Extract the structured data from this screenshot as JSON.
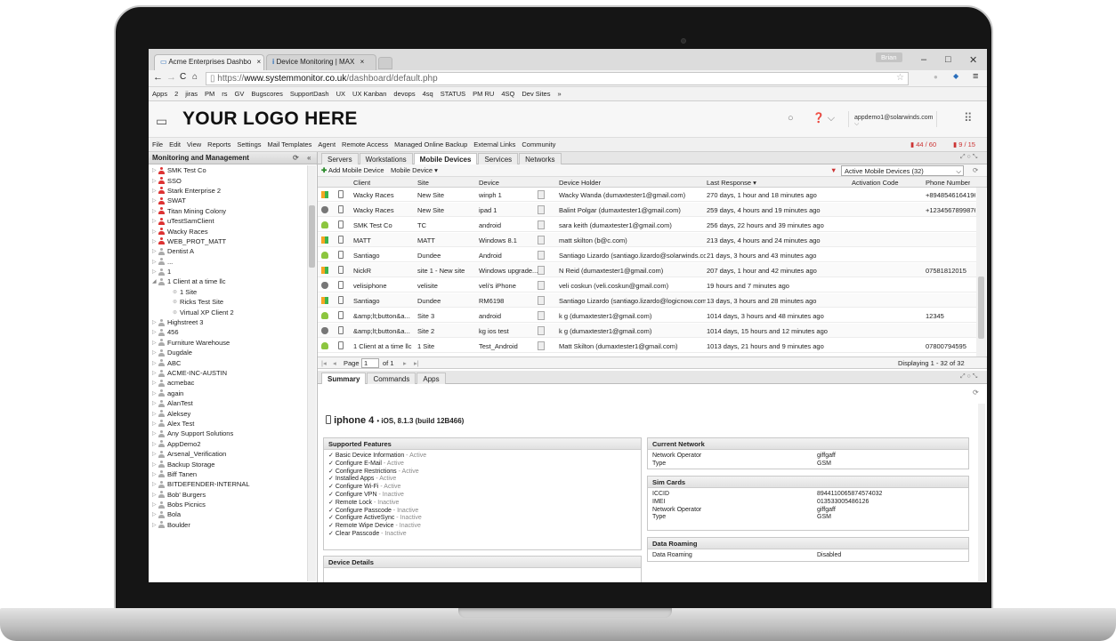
{
  "browser": {
    "tabs": [
      {
        "label": "Acme Enterprises Dashbo"
      },
      {
        "label": "Device Monitoring | MAX"
      }
    ],
    "user_label": "Brian",
    "url_prefix": "https://",
    "url_host": "www.systemmonitor.co.uk",
    "url_path": "/dashboard/default.php",
    "bookmarks": [
      "Apps",
      "2",
      "jiras",
      "PM",
      "rs",
      "GV",
      "Bugscores",
      "SupportDash",
      "UX",
      "UX Kanban",
      "devops",
      "4sq",
      "STATUS",
      "PM RU",
      "4SQ",
      "Dev Sites",
      "»"
    ]
  },
  "header": {
    "logo_text": "YOUR LOGO HERE",
    "account_label": "appdemo1@solarwinds.com"
  },
  "menu": {
    "items": [
      "File",
      "Edit",
      "View",
      "Reports",
      "Settings",
      "Mail Templates",
      "Agent",
      "Remote Access",
      "Managed Online Backup",
      "External Links",
      "Community"
    ],
    "counter1": "44 / 60",
    "counter2": "9 / 15"
  },
  "left_panel": {
    "title": "Monitoring and Management",
    "items": [
      {
        "label": "SMK Test Co",
        "level": 0,
        "icon": "red"
      },
      {
        "label": "SSO",
        "level": 0,
        "icon": "red"
      },
      {
        "label": "Stark Enterprise 2",
        "level": 0,
        "icon": "red"
      },
      {
        "label": "SWAT",
        "level": 0,
        "icon": "red"
      },
      {
        "label": "Titan Mining Colony",
        "level": 0,
        "icon": "red"
      },
      {
        "label": "uTestSamClient",
        "level": 0,
        "icon": "red"
      },
      {
        "label": "Wacky Races",
        "level": 0,
        "icon": "red"
      },
      {
        "label": "WEB_PROT_MATT",
        "level": 0,
        "icon": "red"
      },
      {
        "label": "Dentist A",
        "level": 0,
        "icon": "gray"
      },
      {
        "label": "...",
        "level": 0,
        "icon": "gray"
      },
      {
        "label": "1",
        "level": 0,
        "icon": "gray"
      },
      {
        "label": "1 Client at a time llc",
        "level": 0,
        "icon": "gray"
      },
      {
        "label": "1 Site",
        "level": 1,
        "icon": "site"
      },
      {
        "label": "Ricks Test Site",
        "level": 1,
        "icon": "site"
      },
      {
        "label": "Virtual XP Client 2",
        "level": 1,
        "icon": "site"
      },
      {
        "label": "Highstreet 3",
        "level": 0,
        "icon": "gray"
      },
      {
        "label": "456",
        "level": 0,
        "icon": "gray"
      },
      {
        "label": "Furniture Warehouse",
        "level": 0,
        "icon": "gray"
      },
      {
        "label": "Dugdale",
        "level": 0,
        "icon": "gray"
      },
      {
        "label": "ABC",
        "level": 0,
        "icon": "gray"
      },
      {
        "label": "ACME-INC-AUSTIN",
        "level": 0,
        "icon": "gray"
      },
      {
        "label": "acmebac",
        "level": 0,
        "icon": "gray"
      },
      {
        "label": "again",
        "level": 0,
        "icon": "gray"
      },
      {
        "label": "AlanTest",
        "level": 0,
        "icon": "gray"
      },
      {
        "label": "Aleksey",
        "level": 0,
        "icon": "gray"
      },
      {
        "label": "Alex Test",
        "level": 0,
        "icon": "gray"
      },
      {
        "label": "Any Support Solutions",
        "level": 0,
        "icon": "gray"
      },
      {
        "label": "AppDemo2",
        "level": 0,
        "icon": "gray"
      },
      {
        "label": "Arsenal_Verification",
        "level": 0,
        "icon": "gray"
      },
      {
        "label": "Backup Storage",
        "level": 0,
        "icon": "gray"
      },
      {
        "label": "Biff Tanen",
        "level": 0,
        "icon": "gray"
      },
      {
        "label": "BITDEFENDER-INTERNAL",
        "level": 0,
        "icon": "gray"
      },
      {
        "label": "Bob' Burgers",
        "level": 0,
        "icon": "gray"
      },
      {
        "label": "Bobs Picnics",
        "level": 0,
        "icon": "gray"
      },
      {
        "label": "Bola",
        "level": 0,
        "icon": "gray"
      },
      {
        "label": "Boulder",
        "level": 0,
        "icon": "gray"
      }
    ]
  },
  "main_tabs": [
    "Servers",
    "Workstations",
    "Mobile Devices",
    "Services",
    "Networks"
  ],
  "active_main_tab": "Mobile Devices",
  "toolbar": {
    "add_label": "Add Mobile Device",
    "menu_label": "Mobile Device ▾",
    "filter_value": "Active Mobile Devices (32)"
  },
  "grid": {
    "columns": [
      "Client",
      "Site",
      "Device",
      "Device Holder",
      "Last Response ▾",
      "Activation Code",
      "Phone Number"
    ],
    "rows": [
      {
        "os": "windows",
        "client": "Wacky Races",
        "site": "New Site",
        "device": "winph 1",
        "holder": "Wacky Wanda (dumaxtester1@gmail.com)",
        "last": "270 days, 1 hour and 18 minutes ago",
        "code": "",
        "phone": "+8948546164196..."
      },
      {
        "os": "apple",
        "client": "Wacky Races",
        "site": "New Site",
        "device": "ipad 1",
        "holder": "Balint Polgar (dumaxtester1@gmail.com)",
        "last": "259 days, 4 hours and 19 minutes ago",
        "code": "",
        "phone": "+1234567899876..."
      },
      {
        "os": "android",
        "client": "SMK Test Co",
        "site": "TC",
        "device": "android",
        "holder": "sara keith (dumaxtester1@gmail.com)",
        "last": "256 days, 22 hours and 39 minutes ago",
        "code": "",
        "phone": ""
      },
      {
        "os": "windows",
        "client": "MATT",
        "site": "MATT",
        "device": "Windows 8.1",
        "holder": "matt skilton (b@c.com)",
        "last": "213 days, 4 hours and 24 minutes ago",
        "code": "",
        "phone": ""
      },
      {
        "os": "android",
        "client": "Santiago",
        "site": "Dundee",
        "device": "Android",
        "holder": "Santiago Lizardo (santiago.lizardo@solarwinds.com)",
        "last": "21 days, 3 hours and 43 minutes ago",
        "code": "",
        "phone": ""
      },
      {
        "os": "windows",
        "client": "NickR",
        "site": "site 1 - New site",
        "device": "Windows upgrade...",
        "holder": "N Reid (dumaxtester1@gmail.com)",
        "last": "207 days, 1 hour and 42 minutes ago",
        "code": "",
        "phone": "07581812015"
      },
      {
        "os": "apple",
        "client": "velisiphone",
        "site": "velisite",
        "device": "veli's iPhone",
        "holder": "veli coskun (veli.coskun@gmail.com)",
        "last": "19 hours and 7 minutes ago",
        "code": "",
        "phone": ""
      },
      {
        "os": "windows",
        "client": "Santiago",
        "site": "Dundee",
        "device": "RM6198",
        "holder": "Santiago Lizardo (santiago.lizardo@logicnow.com)",
        "last": "13 days, 3 hours and 28 minutes ago",
        "code": "",
        "phone": ""
      },
      {
        "os": "android",
        "client": "&amp;lt;button&a...",
        "site": "Site 3",
        "device": "android",
        "holder": "k g (dumaxtester1@gmail.com)",
        "last": "1014 days, 3 hours and 48 minutes ago",
        "code": "",
        "phone": "12345"
      },
      {
        "os": "apple",
        "client": "&amp;lt;button&a...",
        "site": "Site 2",
        "device": "kg ios test",
        "holder": "k g (dumaxtester1@gmail.com)",
        "last": "1014 days, 15 hours and 12 minutes ago",
        "code": "",
        "phone": ""
      },
      {
        "os": "android",
        "client": "1 Client at a time llc",
        "site": "1 Site",
        "device": "Test_Android",
        "holder": "Matt Skilton (dumaxtester1@gmail.com)",
        "last": "1013 days, 21 hours and 9 minutes ago",
        "code": "",
        "phone": "07800794595"
      }
    ]
  },
  "pager": {
    "page_label": "Page",
    "page_value": "1",
    "of_label": "of 1",
    "display_text": "Displaying 1 - 32 of 32"
  },
  "sub_tabs": [
    "Summary",
    "Commands",
    "Apps"
  ],
  "active_sub_tab": "Summary",
  "device_summary": {
    "name": "iphone 4",
    "os": "iOS, 8.1.3 (build 12B466)",
    "features_title": "Supported Features",
    "features": [
      {
        "name": "Basic Device Information",
        "status": "Active"
      },
      {
        "name": "Configure E-Mail",
        "status": "Active"
      },
      {
        "name": "Configure Restrictions",
        "status": "Active"
      },
      {
        "name": "Installed Apps",
        "status": "Active"
      },
      {
        "name": "Configure Wi-Fi",
        "status": "Active"
      },
      {
        "name": "Configure VPN",
        "status": "Inactive"
      },
      {
        "name": "Remote Lock",
        "status": "Inactive"
      },
      {
        "name": "Configure Passcode",
        "status": "Inactive"
      },
      {
        "name": "Configure ActiveSync",
        "status": "Inactive"
      },
      {
        "name": "Remote Wipe Device",
        "status": "Inactive"
      },
      {
        "name": "Clear Passcode",
        "status": "Inactive"
      }
    ],
    "device_details_title": "Device Details",
    "current_network": {
      "title": "Current Network",
      "rows": [
        {
          "k": "Network Operator",
          "v": "giffgaff"
        },
        {
          "k": "Type",
          "v": "GSM"
        }
      ]
    },
    "sim_cards": {
      "title": "Sim Cards",
      "rows": [
        {
          "k": "ICCID",
          "v": "8944110065874574032"
        },
        {
          "k": "IMEI",
          "v": "013533005486126"
        },
        {
          "k": "Network Operator",
          "v": "giffgaff"
        },
        {
          "k": "Type",
          "v": "GSM"
        }
      ]
    },
    "data_roaming": {
      "title": "Data Roaming",
      "rows": [
        {
          "k": "Data Roaming",
          "v": "Disabled"
        }
      ]
    }
  },
  "colors": {
    "windows": "#f5a623",
    "apple": "#777777",
    "android": "#8cc63f",
    "accent": "#2a6ebb"
  }
}
